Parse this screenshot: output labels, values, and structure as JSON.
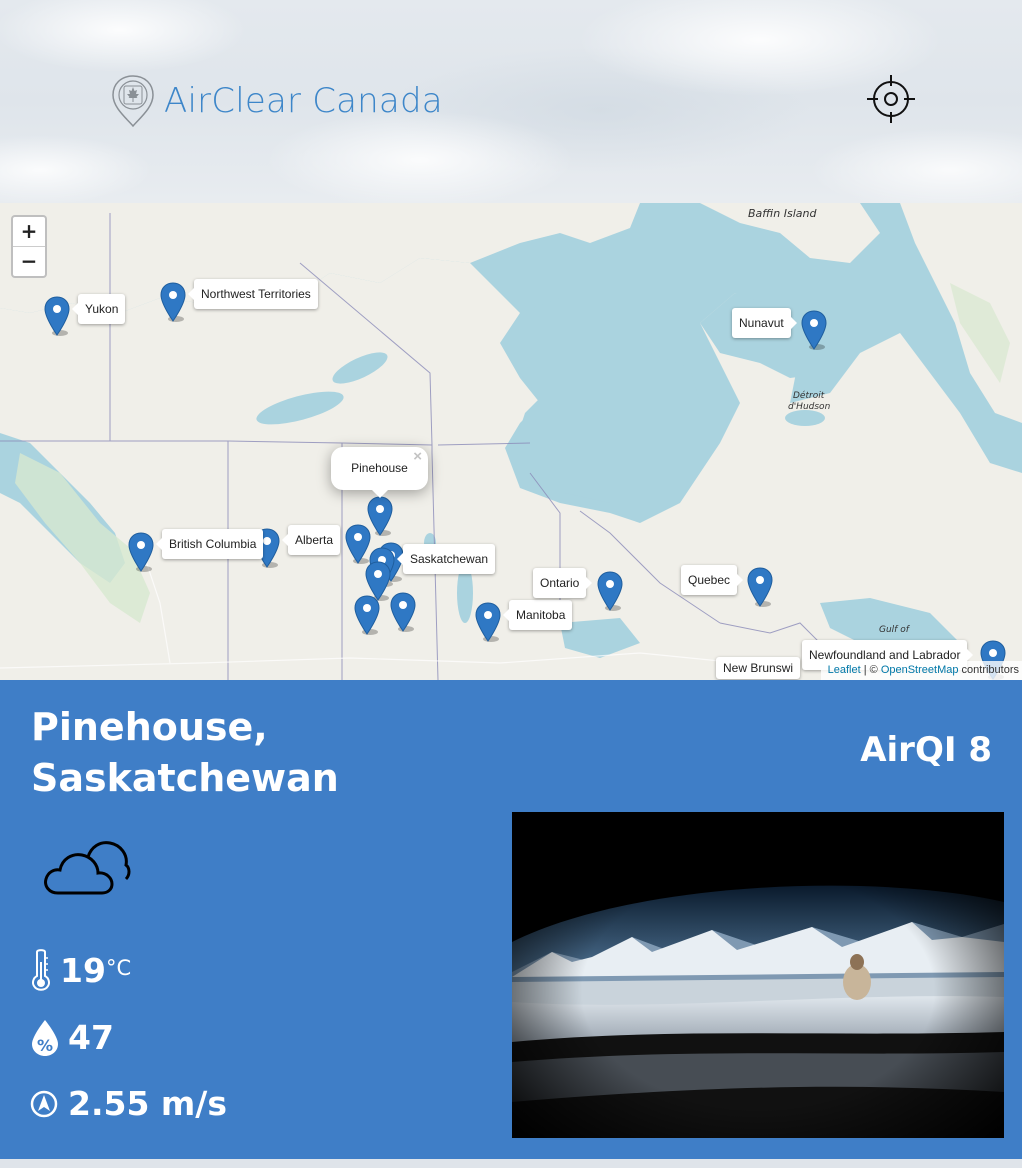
{
  "header": {
    "app_title": "AirClear Canada",
    "locate_icon": "crosshair-icon",
    "brand_color": "#3d86c9"
  },
  "map": {
    "zoom_in_label": "+",
    "zoom_out_label": "−",
    "place_labels": {
      "baffin": "Baffin Island",
      "hudson_line1": "Détroit",
      "hudson_line2": "d'Hudson",
      "gulf": "Gulf of"
    },
    "markers": {
      "yukon": "Yukon",
      "nwt": "Northwest Territories",
      "nunavut": "Nunavut",
      "bc": "British Columbia",
      "alberta": "Alberta",
      "saskatchewan": "Saskatchewan",
      "manitoba": "Manitoba",
      "ontario": "Ontario",
      "quebec": "Quebec",
      "newfoundland": "Newfoundland and Labrador",
      "new_brunswick": "New Brunswi"
    },
    "popup": {
      "title": "Pinehouse",
      "close": "×"
    },
    "attribution": {
      "leaflet": "Leaflet",
      "separator": " | © ",
      "osm": "OpenStreetMap",
      "contributors": " contributors"
    },
    "marker_color": "#2f78c4"
  },
  "panel": {
    "city_line1": "Pinehouse,",
    "city_line2": "Saskatchewan",
    "aqi": "AirQI 8",
    "weather_icon": "cloudy-icon",
    "temperature": "19",
    "temperature_unit": "°C",
    "humidity": "47",
    "wind": "2.55 m/s",
    "background_color": "#3f7ec7"
  }
}
